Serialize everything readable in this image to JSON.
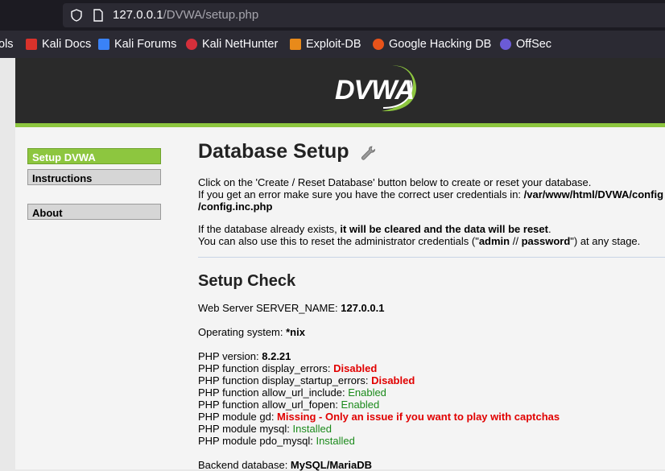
{
  "browser": {
    "url_host": "127.0.0.1",
    "url_path": "/DVWA/setup.php",
    "bookmarks": [
      {
        "label": "ols",
        "icon": "tools-icon",
        "color": "#2b2a33"
      },
      {
        "label": "Kali Docs",
        "icon": "kali-docs-icon",
        "color": "#d9322b"
      },
      {
        "label": "Kali Forums",
        "icon": "kali-forums-icon",
        "color": "#3a82f7"
      },
      {
        "label": "Kali NetHunter",
        "icon": "kali-nethunter-icon",
        "color": "#d42f3b"
      },
      {
        "label": "Exploit-DB",
        "icon": "exploit-db-icon",
        "color": "#e88a1a"
      },
      {
        "label": "Google Hacking DB",
        "icon": "ghdb-icon",
        "color": "#e8531a"
      },
      {
        "label": "OffSec",
        "icon": "offsec-icon",
        "color": "#6b5bd6"
      }
    ]
  },
  "header": {
    "logo_text": "DVWA"
  },
  "menu": {
    "items": [
      {
        "label": "Setup DVWA",
        "selected": true
      },
      {
        "label": "Instructions",
        "selected": false
      },
      {
        "label": "About",
        "selected": false
      }
    ]
  },
  "main": {
    "title": "Database Setup",
    "intro": {
      "line1": "Click on the 'Create / Reset Database' button below to create or reset your database.",
      "line2_prefix": "If you get an error make sure you have the correct user credentials in: ",
      "line2_path": "/var/www/html/DVWA/config",
      "line3_path": "/config.inc.php",
      "line4_prefix": "If the database already exists, ",
      "line4_bold": "it will be cleared and the data will be reset",
      "line4_suffix": ".",
      "line5_prefix": "You can also use this to reset the administrator credentials (\"",
      "line5_user": "admin",
      "line5_sep": " // ",
      "line5_pass": "password",
      "line5_suffix": "\") at any stage."
    },
    "setup_check": {
      "title": "Setup Check",
      "server_name_label": "Web Server SERVER_NAME: ",
      "server_name_value": "127.0.0.1",
      "os_label": "Operating system: ",
      "os_value": "*nix",
      "php_version_label": "PHP version: ",
      "php_version_value": "8.2.21",
      "checks": [
        {
          "label": "PHP function display_errors: ",
          "value": "Disabled",
          "status": "red"
        },
        {
          "label": "PHP function display_startup_errors: ",
          "value": "Disabled",
          "status": "red"
        },
        {
          "label": "PHP function allow_url_include: ",
          "value": "Enabled",
          "status": "green"
        },
        {
          "label": "PHP function allow_url_fopen: ",
          "value": "Enabled",
          "status": "green"
        },
        {
          "label": "PHP module gd: ",
          "value": "Missing - Only an issue if you want to play with captchas",
          "status": "red"
        },
        {
          "label": "PHP module mysql: ",
          "value": "Installed",
          "status": "green"
        },
        {
          "label": "PHP module pdo_mysql: ",
          "value": "Installed",
          "status": "green"
        }
      ],
      "backend_label": "Backend database: ",
      "backend_value": "MySQL/MariaDB"
    }
  },
  "colors": {
    "accent_green": "#8dc63f",
    "error_red": "#e10000",
    "ok_green": "#1b8a1b"
  }
}
